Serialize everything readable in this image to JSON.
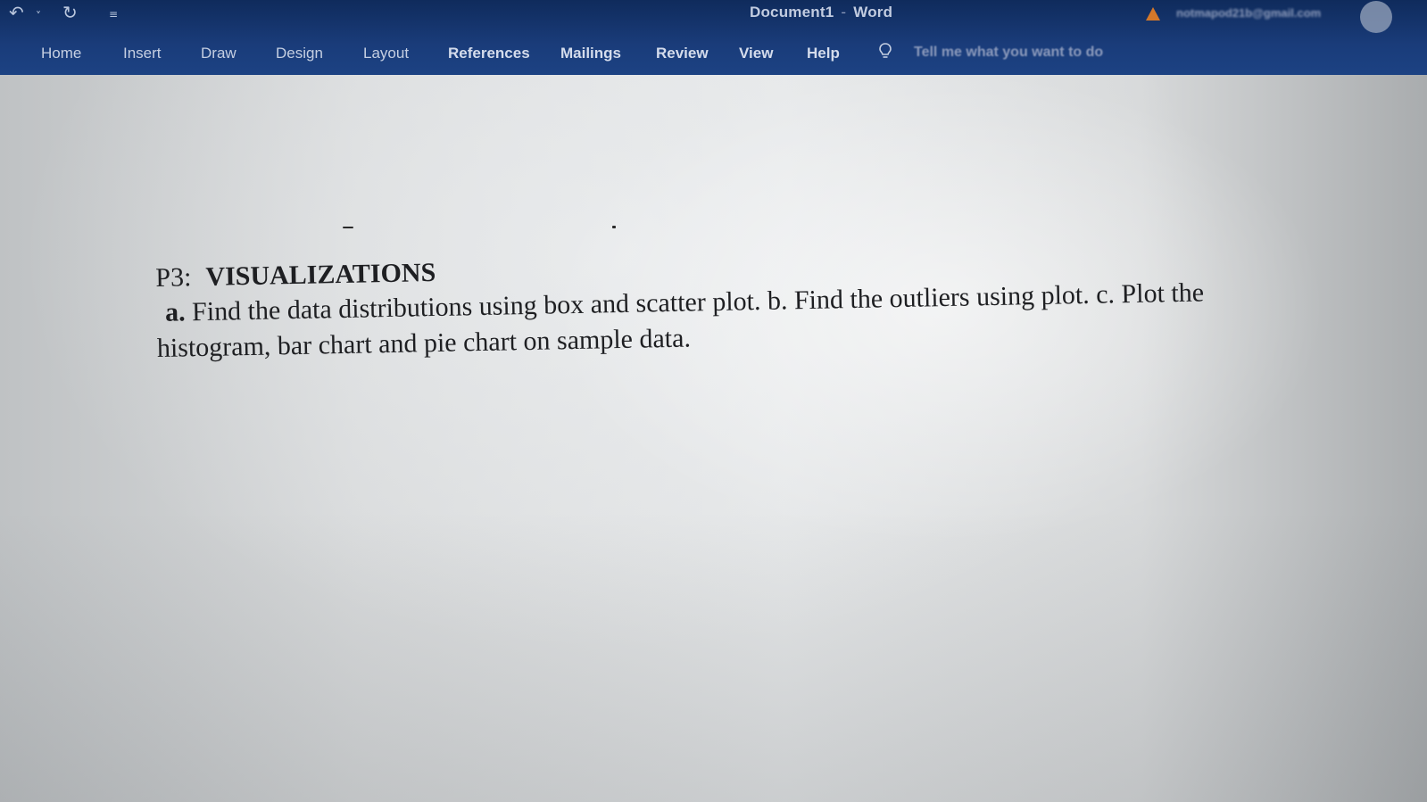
{
  "window": {
    "document_name": "Document1",
    "app_name": "Word",
    "account_email": "notmapod21b@gmail.com"
  },
  "quick_access": {
    "undo_icon": "undo-icon",
    "redo_icon": "redo-icon",
    "customize_icon": "customize-qat-icon"
  },
  "ribbon": {
    "tabs": [
      {
        "label": "Home"
      },
      {
        "label": "Insert"
      },
      {
        "label": "Draw"
      },
      {
        "label": "Design"
      },
      {
        "label": "Layout"
      },
      {
        "label": "References"
      },
      {
        "label": "Mailings"
      },
      {
        "label": "Review"
      },
      {
        "label": "View"
      },
      {
        "label": "Help"
      }
    ],
    "tell_me_placeholder": "Tell me what you want to do"
  },
  "document": {
    "heading_label": "P3:",
    "heading_title": "VISUALIZATIONS",
    "para_a_marker": "a.",
    "para_line1": "Find the data distributions using box and scatter plot. b. Find the outliers using plot. c. Plot the",
    "para_line2": "histogram, bar chart and pie chart on sample data."
  },
  "colors": {
    "ribbon_background": "#1a3c7a",
    "page_background": "#e4e6e7",
    "text": "#1e1f22",
    "warning": "#d4782a"
  }
}
